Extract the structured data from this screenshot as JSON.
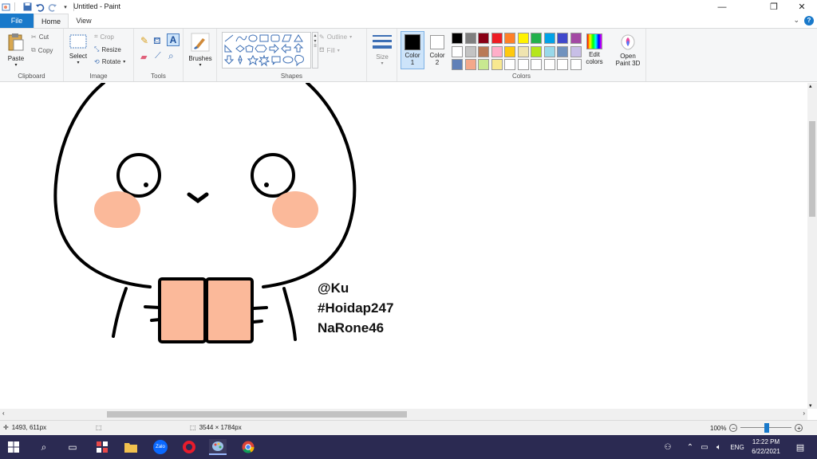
{
  "window": {
    "title": "Untitled - Paint",
    "minimize_icon": "minimize-icon",
    "maximize_icon": "restore-icon",
    "close_icon": "close-icon"
  },
  "quick_access": [
    "paint-app-icon",
    "save-icon",
    "undo-icon",
    "redo-icon",
    "customize-dropdown-icon"
  ],
  "tabs": [
    {
      "label": "File"
    },
    {
      "label": "Home"
    },
    {
      "label": "View"
    }
  ],
  "ribbon": {
    "clipboard": {
      "group_label": "Clipboard",
      "paste": "Paste",
      "cut": "Cut",
      "copy": "Copy"
    },
    "image": {
      "group_label": "Image",
      "select": "Select",
      "crop": "Crop",
      "resize": "Resize",
      "rotate": "Rotate"
    },
    "tools": {
      "group_label": "Tools"
    },
    "brushes": {
      "label": "Brushes"
    },
    "shapes": {
      "group_label": "Shapes",
      "outline": "Outline",
      "fill": "Fill"
    },
    "size": {
      "label": "Size"
    },
    "colors": {
      "group_label": "Colors",
      "color1_label": "Color 1",
      "color1_line1": "Color",
      "color1_line2": "1",
      "color2_line1": "Color",
      "color2_line2": "2",
      "color1_value": "#000000",
      "color2_value": "#ffffff",
      "edit_colors_line1": "Edit",
      "edit_colors_line2": "colors",
      "palette_row1": [
        "#000000",
        "#7f7f7f",
        "#880015",
        "#ed1c24",
        "#ff7f27",
        "#fff200",
        "#22b14c",
        "#00a2e8",
        "#3f48cc",
        "#a349a4"
      ],
      "palette_row2": [
        "#ffffff",
        "#c3c3c3",
        "#b97a57",
        "#ffaec9",
        "#ffc90e",
        "#efe4b0",
        "#b5e61d",
        "#99d9ea",
        "#7092be",
        "#c8bfe7"
      ],
      "palette_row3": [
        "#6080b8",
        "#f4a88a",
        "#c8e890",
        "#f8e890",
        "#ffffff",
        "#ffffff",
        "#ffffff",
        "#ffffff",
        "#ffffff",
        "#ffffff"
      ]
    },
    "paint3d": {
      "line1": "Open",
      "line2": "Paint 3D"
    }
  },
  "drawing": {
    "watermark_lines": [
      "@Ku",
      "#Hoidap247",
      "NaRone46"
    ],
    "blush_color": "#fbb99a",
    "book_color": "#fbb99a",
    "stroke_color": "#000000"
  },
  "status": {
    "cursor_pos": "1493, 611px",
    "image_size": "3544 × 1784px",
    "zoom": "100%"
  },
  "taskbar": {
    "time": "12:22 PM",
    "date": "6/22/2021",
    "lang": "ENG",
    "apps": [
      "windows-start-icon",
      "search-icon",
      "task-view-icon",
      "zalo-app-icon",
      "file-explorer-icon",
      "zalo-chat-icon",
      "opera-browser-icon",
      "paint-app-icon",
      "chrome-browser-icon"
    ]
  }
}
